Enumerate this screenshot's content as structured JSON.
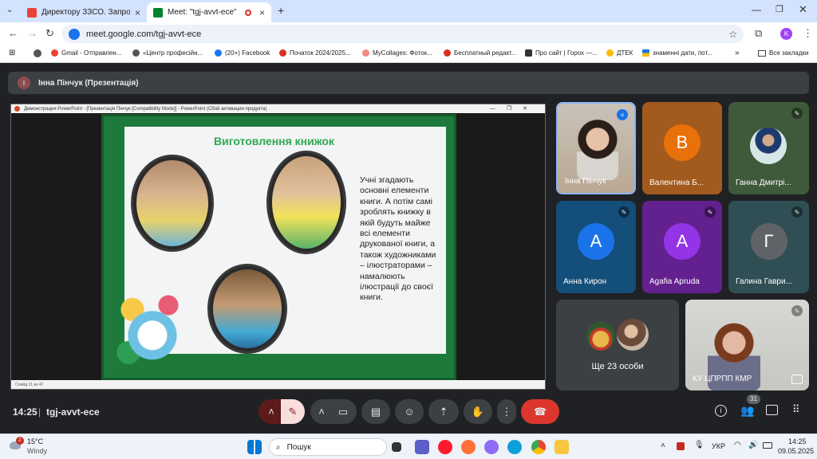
{
  "tabs": [
    {
      "title": "Директору ЗЗСО. Запрошення"
    },
    {
      "title": "Meet: \"tgj-avvt-ece\""
    }
  ],
  "address": {
    "url": "meet.google.com/tgj-avvt-ece"
  },
  "profile": "K",
  "bookmarks": [
    "Gmail - Отправлен...",
    "«Центр професійн...",
    "(20+) Facebook",
    "Початок 2024/2025...",
    "MyCollages: Фоток...",
    "Бесплатный редакт...",
    "Про сайт | Горох —...",
    "ДТЕК",
    "знаменні дати, пот...",
    "Все закладки"
  ],
  "presenter": {
    "initial": "І",
    "label": "Інна Пінчук (Презентація)"
  },
  "ppt": {
    "window_title": "Демонстрация PowerPoint - [Презентація Пінчук [Compatibility Mode]] - PowerPoint (Сбой активации продукта)",
    "status": "Слайд 31 из 47"
  },
  "slide": {
    "title": "Виготовлення книжок",
    "text": "Учні згадають основні елементи книги. А потім самі зроблять книжку в якій будуть майже всі елементи друкованої книги, а також художниками – ілюстраторами – намалюють ілюстрації до своєї книги."
  },
  "participants": [
    {
      "name": "Інна Пінчук"
    },
    {
      "name": "Валентина Б...",
      "initial": "В",
      "color": "#e8710a"
    },
    {
      "name": "Ганна Дмитрі..."
    },
    {
      "name": "Анна Кирон",
      "initial": "А",
      "color": "#1a73e8"
    },
    {
      "name": "Agafia Apruda",
      "initial": "А",
      "color": "#9334e6"
    },
    {
      "name": "Галина Гаври...",
      "initial": "Г",
      "color": "#5f6368"
    },
    {
      "name": "Ще 23 особи"
    },
    {
      "name": "КУ ЦПРПП КМР"
    }
  ],
  "meeting": {
    "time": "14:25",
    "code": "tgj-avvt-ece",
    "people_count": "31"
  },
  "taskbar": {
    "temp": "15°C",
    "weather": "Windy",
    "search": "Пошук",
    "lang": "УКР",
    "time": "14:25",
    "date": "09.05.2025",
    "notif": "2"
  }
}
